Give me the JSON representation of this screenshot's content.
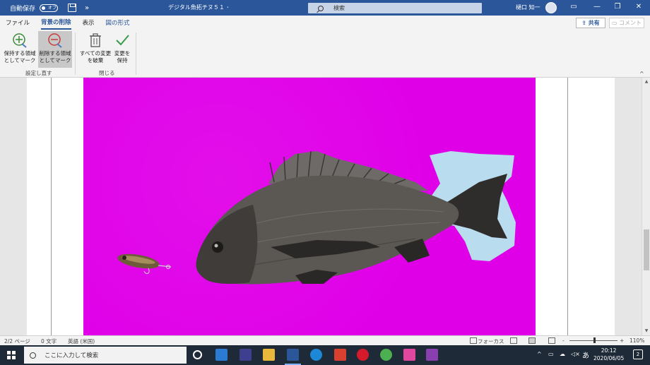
{
  "titlebar": {
    "autosave_label": "自動保存",
    "autosave_state": "オフ",
    "more": "»",
    "doc_title": "デジタル魚拓チヌ５１ ･",
    "search_placeholder": "検索",
    "user_name": "樋口 知一",
    "minimize": "—",
    "restore": "❐",
    "close": "✕"
  },
  "ribbon_tabs": {
    "file": "ファイル",
    "background_removal": "背景の削除",
    "view": "表示",
    "picture_format": "図の形式",
    "share": "共有",
    "comment": "コメント"
  },
  "ribbon": {
    "mark_keep": [
      "保持する領域",
      "としてマーク"
    ],
    "mark_remove": [
      "削除する領域",
      "としてマーク"
    ],
    "group_refine": "設定し直す",
    "discard_all": [
      "すべての変更",
      "を破棄"
    ],
    "keep_changes": [
      "変更を",
      "保持"
    ],
    "group_close": "閉じる",
    "collapse": "^"
  },
  "statusbar": {
    "page": "2/2 ページ",
    "words": "0 文字",
    "language": "英語 (米国)",
    "focus": "フォーカス",
    "zoom": "110%",
    "zoom_minus": "-",
    "zoom_plus": "+"
  },
  "taskbar": {
    "search_placeholder": "ここに入力して検索",
    "time": "20:12",
    "date": "2020/06/05",
    "ime": "あ",
    "notifications": "2"
  },
  "colors": {
    "title_blue": "#2b579a",
    "canvas_magenta": "#e000e8",
    "taskbar": "#1f2a38"
  }
}
